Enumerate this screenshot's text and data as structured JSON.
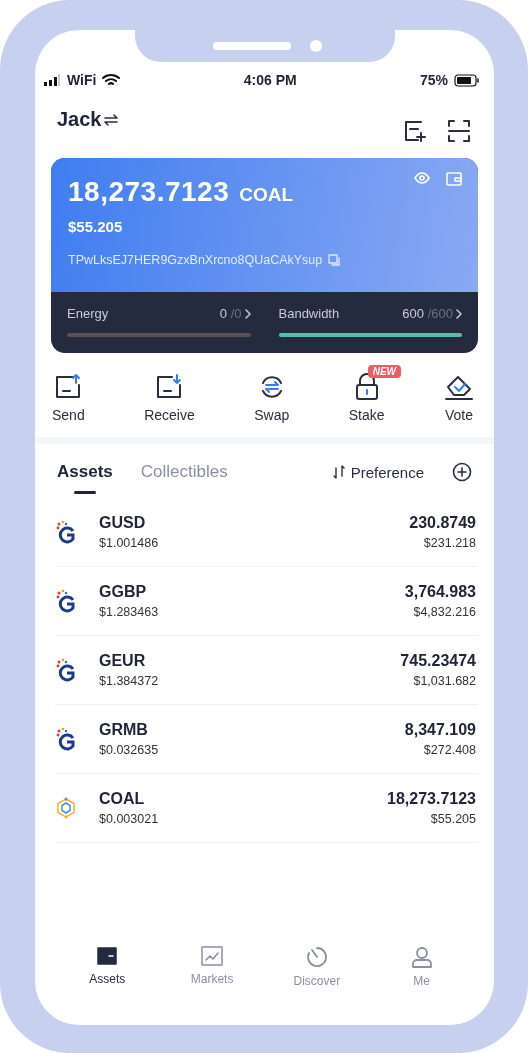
{
  "status_bar": {
    "carrier": "WiFi",
    "time": "4:06 PM",
    "battery": "75%"
  },
  "header": {
    "account": "Jack"
  },
  "balance_card": {
    "amount": "18,273.7123",
    "unit": "COAL",
    "fiat": "$55.205",
    "address": "TPwLksEJ7HER9GzxBnXrcno8QUaCAkYsup",
    "resources": [
      {
        "label": "Energy",
        "value": "0",
        "limit": "/0",
        "level": 0
      },
      {
        "label": "Bandwidth",
        "value": "600",
        "limit": "/600",
        "level": 1
      }
    ]
  },
  "actions": [
    {
      "label": "Send"
    },
    {
      "label": "Receive"
    },
    {
      "label": "Swap"
    },
    {
      "label": "Stake",
      "badge": "NEW"
    },
    {
      "label": "Vote"
    }
  ],
  "tabs": [
    {
      "label": "Assets",
      "selected": true
    },
    {
      "label": "Collectibles",
      "selected": false
    }
  ],
  "preference": "Preference",
  "assets": [
    {
      "kind": "g",
      "symbol": "GUSD",
      "price": "$1.001486",
      "amount": "230.8749",
      "value": "$231.218"
    },
    {
      "kind": "g",
      "symbol": "GGBP",
      "price": "$1.283463",
      "amount": "3,764.983",
      "value": "$4,832.216"
    },
    {
      "kind": "g",
      "symbol": "GEUR",
      "price": "$1.384372",
      "amount": "745.23474",
      "value": "$1,031.682"
    },
    {
      "kind": "g",
      "symbol": "GRMB",
      "price": "$0.032635",
      "amount": "8,347.109",
      "value": "$272.408"
    },
    {
      "kind": "coal",
      "symbol": "COAL",
      "price": "$0.003021",
      "amount": "18,273.7123",
      "value": "$55.205"
    }
  ],
  "nav": [
    {
      "label": "Assets",
      "selected": true
    },
    {
      "label": "Markets",
      "selected": false
    },
    {
      "label": "Discover",
      "selected": false
    },
    {
      "label": "Me",
      "selected": false
    }
  ]
}
